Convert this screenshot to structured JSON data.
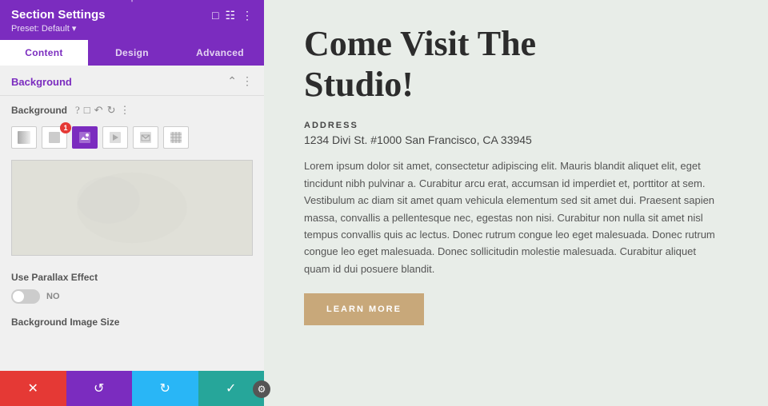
{
  "panel": {
    "title": "Section Settings",
    "preset": "Preset: Default ▾",
    "tabs": [
      "Content",
      "Design",
      "Advanced"
    ],
    "active_tab": "Content",
    "background_section": {
      "title": "Background",
      "bg_label": "Background",
      "type_buttons": [
        "gradient-icon",
        "color-swatch-icon",
        "image-icon",
        "video-icon",
        "email-icon",
        "pattern-icon"
      ],
      "badge_index": 1,
      "badge_value": "1"
    },
    "parallax": {
      "label": "Use Parallax Effect",
      "toggle_value": "NO"
    },
    "bg_image_size_label": "Background Image Size"
  },
  "action_bar": {
    "cancel_icon": "✕",
    "undo_icon": "↺",
    "redo_icon": "↻",
    "confirm_icon": "✓"
  },
  "main": {
    "title_line1": "Come Visit The",
    "title_line2": "Studio!",
    "address_label": "ADDRESS",
    "address_value": "1234 Divi St. #1000 San Francisco, CA 33945",
    "body_text": "Lorem ipsum dolor sit amet, consectetur adipiscing elit. Mauris blandit aliquet elit, eget tincidunt nibh pulvinar a. Curabitur arcu erat, accumsan id imperdiet et, porttitor at sem. Vestibulum ac diam sit amet quam vehicula elementum sed sit amet dui. Praesent sapien massa, convallis a pellentesque nec, egestas non nisi. Curabitur non nulla sit amet nisl tempus convallis quis ac lectus. Donec rutrum congue leo eget malesuada. Donec rutrum congue leo eget malesuada. Donec sollicitudin molestie malesuada. Curabitur aliquet quam id dui posuere blandit.",
    "learn_more_label": "LEARN MORE"
  }
}
